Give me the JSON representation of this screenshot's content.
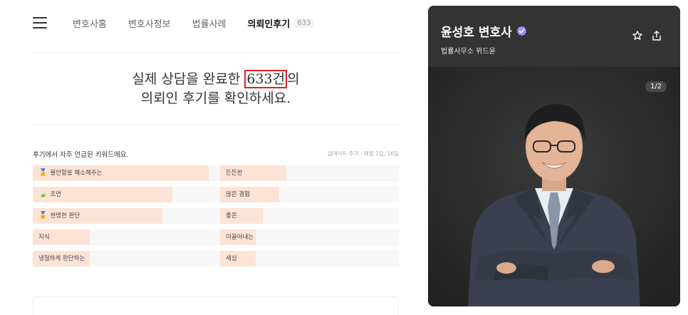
{
  "nav": {
    "menu_icon": "hamburger-menu-icon",
    "items": [
      {
        "label": "변호사홈"
      },
      {
        "label": "변호사정보"
      },
      {
        "label": "법률사례"
      },
      {
        "label": "의뢰인후기",
        "count": "633"
      }
    ]
  },
  "headline": {
    "line1_before": "실제 상담을 완료한 ",
    "line1_highlight": "633건",
    "line1_after": "의",
    "line2": "의뢰인 후기를 확인하세요."
  },
  "keywords": {
    "title": "후기에서 자주 언급된 키워드에요.",
    "update_note": "업데이트 주기 : 매월 1일, 16일",
    "items": [
      {
        "label": "불안함을 해소해주는",
        "emoji": "🏅",
        "fraction": 0.92
      },
      {
        "label": "조언",
        "emoji": "🍃",
        "fraction": 0.73
      },
      {
        "label": "현명한 판단",
        "emoji": "🏅",
        "fraction": 0.68
      },
      {
        "label": "지식",
        "emoji": "",
        "fraction": 0.3
      },
      {
        "label": "냉철하게 판단하는",
        "emoji": "",
        "fraction": 0.3
      },
      {
        "label": "든든한",
        "emoji": "",
        "fraction": 0.37
      },
      {
        "label": "많은 경험",
        "emoji": "",
        "fraction": 0.33
      },
      {
        "label": "좋은",
        "emoji": "",
        "fraction": 0.24
      },
      {
        "label": "이끌어내는",
        "emoji": "",
        "fraction": 0.2
      },
      {
        "label": "세심",
        "emoji": "",
        "fraction": 0.2
      }
    ]
  },
  "lawyer": {
    "name": "윤성호 변호사",
    "firm": "법률사무소 위드윤",
    "verified_icon": "verified-badge-icon",
    "favorite_icon": "star-outline-icon",
    "share_icon": "share-icon",
    "photo_pager": "1/2"
  },
  "colors": {
    "bar_fill": "#fde3d6",
    "bar_track": "#f7f7f7",
    "highlight_box": "#e02020",
    "verified": "#a78bfa",
    "card_bg": "#2b2b2b"
  }
}
